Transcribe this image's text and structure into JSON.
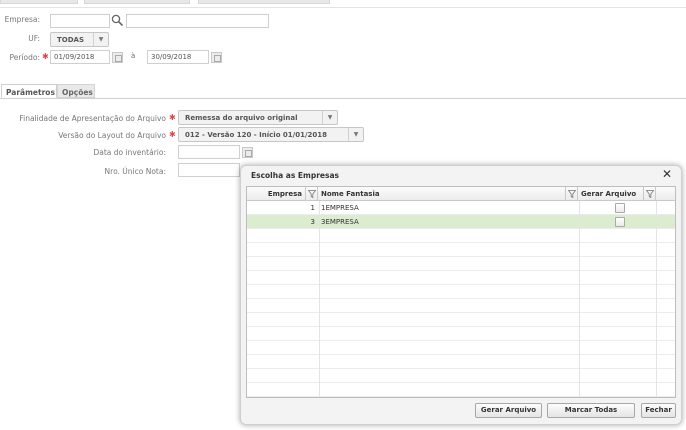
{
  "filters": {
    "empresa_label": "Empresa:",
    "uf_label": "UF:",
    "uf_value": "TODAS",
    "periodo_label": "Período:",
    "periodo_start": "01/09/2018",
    "periodo_sep": "à",
    "periodo_end": "30/09/2018"
  },
  "tabs": [
    {
      "label": "Parâmetros",
      "active": true
    },
    {
      "label": "Opções",
      "active": false
    }
  ],
  "params": {
    "finalidade_label": "Finalidade de Apresentação do Arquivo",
    "finalidade_value": "Remessa do arquivo original",
    "versao_label": "Versão do Layout do Arquivo",
    "versao_value": "012 - Versão 120 - Início 01/01/2018",
    "data_inventario_label": "Data do inventário:",
    "nro_unico_label": "Nro. Único Nota:"
  },
  "modal": {
    "title": "Escolha as Empresas",
    "columns": {
      "empresa": "Empresa",
      "nome": "Nome Fantasia",
      "gerar": "Gerar Arquivo"
    },
    "rows": [
      {
        "empresa": "1",
        "nome": "1EMPRESA",
        "gerar": false,
        "selected": false
      },
      {
        "empresa": "3",
        "nome": "3EMPRESA",
        "gerar": false,
        "selected": true
      }
    ],
    "buttons": {
      "gerar": "Gerar Arquivo",
      "marcar": "Marcar Todas",
      "fechar": "Fechar"
    }
  },
  "colors": {
    "selected_row": "#dbeccf",
    "required": "#dd4444"
  }
}
